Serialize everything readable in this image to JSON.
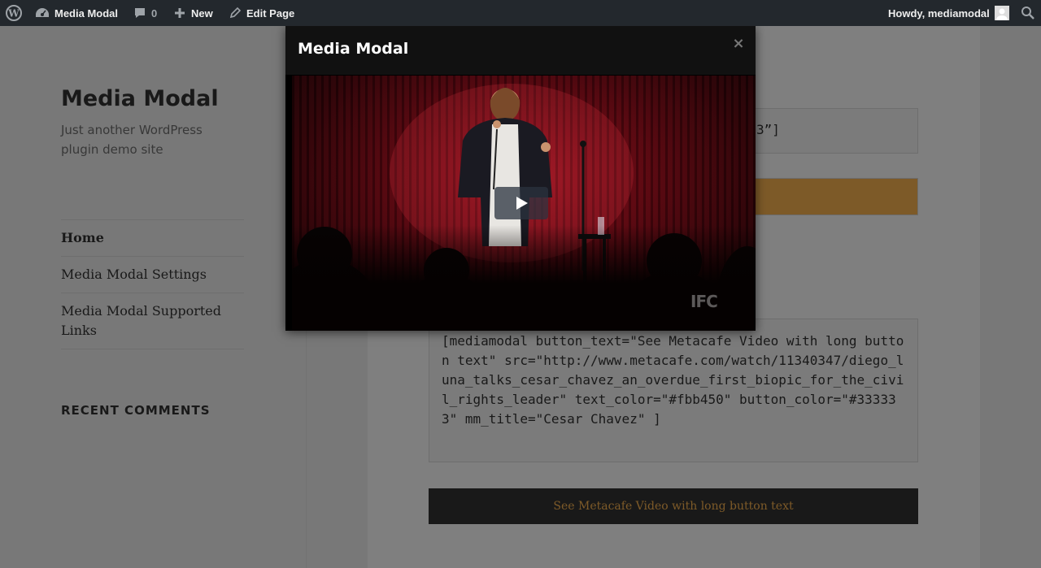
{
  "adminbar": {
    "site_name": "Media Modal",
    "comments_count": "0",
    "new_label": "New",
    "edit_label": "Edit Page",
    "howdy": "Howdy, mediamodal"
  },
  "site": {
    "title": "Media Modal",
    "description": "Just another WordPress plugin demo site"
  },
  "nav": {
    "items": [
      {
        "label": "Home"
      },
      {
        "label": "Media Modal Settings"
      },
      {
        "label": "Media Modal Supported Links"
      }
    ]
  },
  "widgets": {
    "recent_comments_title": "RECENT COMMENTS"
  },
  "content": {
    "code_top_partial": "3”]",
    "code_main": "[mediamodal button_text=\"See Metacafe Video with long button text\" src=\"http://www.metacafe.com/watch/11340347/diego_luna_talks_cesar_chavez_an_overdue_first_biopic_for_the_civil_rights_leader\" text_color=\"#fbb450\" button_color=\"#333333\" mm_title=\"Cesar Chavez\" ]",
    "button_label": "See Metacafe Video with long button text",
    "button_text_color": "#fbb450",
    "button_color": "#333333"
  },
  "modal": {
    "title": "Media Modal",
    "close": "×",
    "watermark": "IFC"
  },
  "icons": {
    "wp": "wordpress-logo-icon",
    "dashboard": "dashboard-icon",
    "comment": "comment-icon",
    "plus": "plus-icon",
    "edit": "pencil-icon",
    "avatar": "avatar-icon",
    "search": "search-icon",
    "play": "play-icon"
  }
}
